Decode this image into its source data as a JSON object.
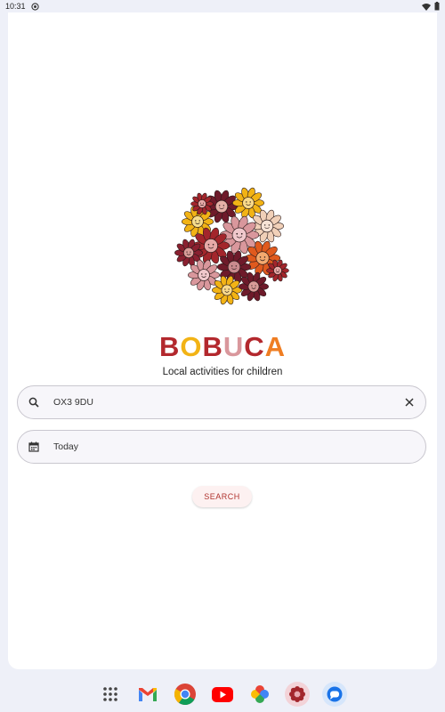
{
  "status": {
    "time": "10:31"
  },
  "app": {
    "brand_letters": [
      "B",
      "O",
      "B",
      "U",
      "C",
      "A"
    ],
    "brand_colors": [
      "#b3282d",
      "#f2b315",
      "#b3282d",
      "#d9979c",
      "#b3282d",
      "#ef7d22"
    ],
    "tagline": "Local activities for children"
  },
  "search": {
    "value": "OX3 9DU",
    "icon": "search-icon",
    "clear_icon": "close-icon"
  },
  "date": {
    "value": "Today",
    "icon": "calendar-icon"
  },
  "search_button": {
    "label": "SEARCH"
  },
  "dock": {
    "apps": [
      "app-drawer-icon",
      "gmail-icon",
      "chrome-icon",
      "youtube-icon",
      "photos-icon",
      "flower-app-icon",
      "messages-icon"
    ]
  },
  "colors": {
    "accent": "#b0332e",
    "background": "#eef0f8"
  }
}
